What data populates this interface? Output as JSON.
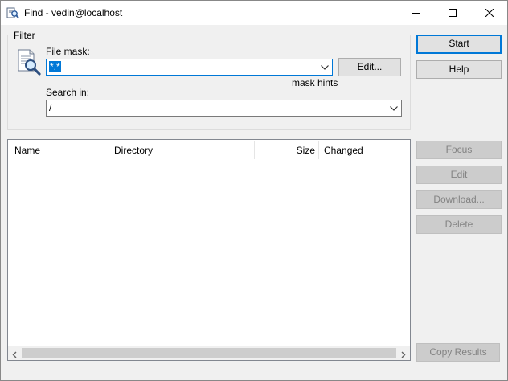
{
  "window": {
    "title": "Find - vedin@localhost",
    "icon": "find-window-icon"
  },
  "filter": {
    "group_label": "Filter",
    "file_mask_label": "File mask:",
    "file_mask_value": "*.*",
    "edit_label": "Edit...",
    "mask_hints_label": "mask hints",
    "search_in_label": "Search in:",
    "search_in_value": "/"
  },
  "buttons": {
    "start": "Start",
    "help": "Help",
    "focus": "Focus",
    "edit": "Edit",
    "download": "Download...",
    "delete": "Delete",
    "copy_results": "Copy Results"
  },
  "results": {
    "columns": [
      "Name",
      "Directory",
      "Size",
      "Changed"
    ],
    "rows": []
  },
  "colors": {
    "accent": "#0078d7",
    "disabled_text": "#838383"
  }
}
